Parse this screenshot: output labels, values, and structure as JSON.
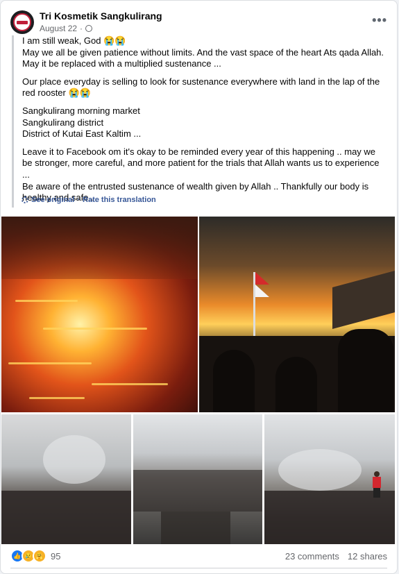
{
  "post": {
    "page_name": "Tri Kosmetik Sangkulirang",
    "date": "August 22",
    "more_label": "•••",
    "paragraphs": [
      [
        "I am still weak, God 😭😭",
        "May we all be given patience without limits. And the vast space of the heart Ats qada Allah.",
        "May it be replaced with a multiplied sustenance ..."
      ],
      [
        "Our place everyday is selling to look for sustenance everywhere with land in the lap of the red rooster 😭😭"
      ],
      [
        "Sangkulirang morning market",
        "Sangkulirang district",
        "District of Kutai East Kaltim ..."
      ],
      [
        "Leave it to Facebook om it's okay to be reminded every year of this happening .. may we be stronger, more careful, and more patient for the trials that Allah wants us to experience ...",
        "Be aware of the entrusted sustenance of wealth given by Allah .. Thankfully our body is healthy and safe.."
      ]
    ],
    "see_original": "See original",
    "separator": "·",
    "rate_translation": "Rate this translation"
  },
  "footer": {
    "reaction_count": "95",
    "comments": "23 comments",
    "shares": "12 shares"
  },
  "colors": {
    "link": "#385898",
    "brand_blue": "#1877f2",
    "avatar_ring": "#c01f3a"
  }
}
